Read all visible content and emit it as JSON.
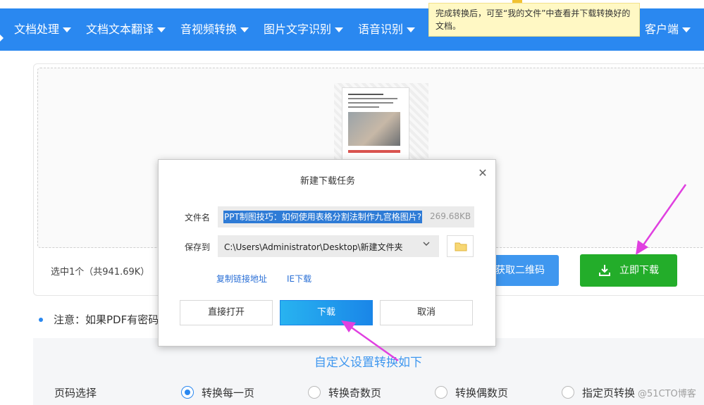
{
  "nav": {
    "items": [
      {
        "label": "文档处理"
      },
      {
        "label": "文档文本翻译"
      },
      {
        "label": "音视频转换"
      },
      {
        "label": "图片文字识别"
      },
      {
        "label": "语音识别"
      },
      {
        "label": "客户端"
      }
    ]
  },
  "tooltip": {
    "text": "完成转换后，可至“我的文件”中查看并下载转换好的文档。"
  },
  "upload": {
    "selected_info": "选中1个（共941.69K）",
    "qr_button": "获取二维码",
    "download_now": "立即下载"
  },
  "notice": {
    "text": "注意：如果PDF有密码"
  },
  "settings": {
    "title": "自定义设置转换如下",
    "page_label": "页码选择",
    "options": [
      {
        "label": "转换每一页",
        "selected": true
      },
      {
        "label": "转换奇数页",
        "selected": false
      },
      {
        "label": "转换偶数页",
        "selected": false
      },
      {
        "label": "指定页转换",
        "selected": false
      }
    ]
  },
  "watermark": "@51CTO博客",
  "dialog": {
    "title": "新建下载任务",
    "filename_label": "文件名",
    "filename": "PPT制图技巧：如何使用表格分割法制作九宫格图片?",
    "filesize": "269.68KB",
    "saveto_label": "保存到",
    "save_path": "C:\\Users\\Administrator\\Desktop\\新建文件夹",
    "copy_link": "复制链接地址",
    "ie_download": "IE下载",
    "open_button": "直接打开",
    "download_button": "下载",
    "cancel_button": "取消"
  },
  "colors": {
    "nav_bg": "#2a88f0",
    "download_green": "#23ad2a",
    "primary_blue": "#1a86e8",
    "annotation_arrow": "#e040e0"
  }
}
